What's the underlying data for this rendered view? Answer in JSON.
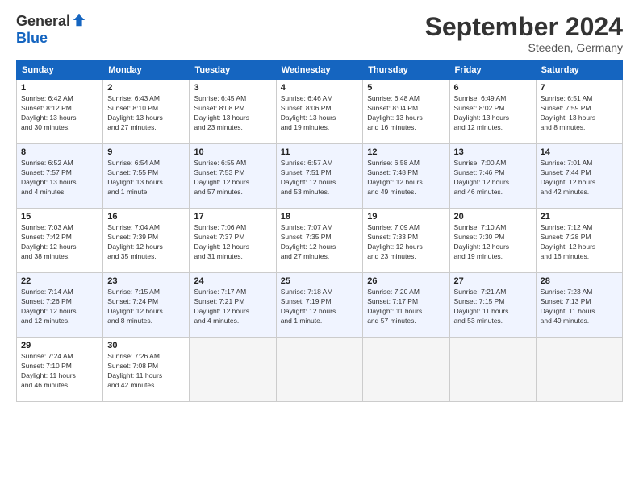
{
  "header": {
    "logo_general": "General",
    "logo_blue": "Blue",
    "month_title": "September 2024",
    "subtitle": "Steeden, Germany"
  },
  "weekdays": [
    "Sunday",
    "Monday",
    "Tuesday",
    "Wednesday",
    "Thursday",
    "Friday",
    "Saturday"
  ],
  "weeks": [
    [
      {
        "day": "1",
        "info": "Sunrise: 6:42 AM\nSunset: 8:12 PM\nDaylight: 13 hours\nand 30 minutes."
      },
      {
        "day": "2",
        "info": "Sunrise: 6:43 AM\nSunset: 8:10 PM\nDaylight: 13 hours\nand 27 minutes."
      },
      {
        "day": "3",
        "info": "Sunrise: 6:45 AM\nSunset: 8:08 PM\nDaylight: 13 hours\nand 23 minutes."
      },
      {
        "day": "4",
        "info": "Sunrise: 6:46 AM\nSunset: 8:06 PM\nDaylight: 13 hours\nand 19 minutes."
      },
      {
        "day": "5",
        "info": "Sunrise: 6:48 AM\nSunset: 8:04 PM\nDaylight: 13 hours\nand 16 minutes."
      },
      {
        "day": "6",
        "info": "Sunrise: 6:49 AM\nSunset: 8:02 PM\nDaylight: 13 hours\nand 12 minutes."
      },
      {
        "day": "7",
        "info": "Sunrise: 6:51 AM\nSunset: 7:59 PM\nDaylight: 13 hours\nand 8 minutes."
      }
    ],
    [
      {
        "day": "8",
        "info": "Sunrise: 6:52 AM\nSunset: 7:57 PM\nDaylight: 13 hours\nand 4 minutes."
      },
      {
        "day": "9",
        "info": "Sunrise: 6:54 AM\nSunset: 7:55 PM\nDaylight: 13 hours\nand 1 minute."
      },
      {
        "day": "10",
        "info": "Sunrise: 6:55 AM\nSunset: 7:53 PM\nDaylight: 12 hours\nand 57 minutes."
      },
      {
        "day": "11",
        "info": "Sunrise: 6:57 AM\nSunset: 7:51 PM\nDaylight: 12 hours\nand 53 minutes."
      },
      {
        "day": "12",
        "info": "Sunrise: 6:58 AM\nSunset: 7:48 PM\nDaylight: 12 hours\nand 49 minutes."
      },
      {
        "day": "13",
        "info": "Sunrise: 7:00 AM\nSunset: 7:46 PM\nDaylight: 12 hours\nand 46 minutes."
      },
      {
        "day": "14",
        "info": "Sunrise: 7:01 AM\nSunset: 7:44 PM\nDaylight: 12 hours\nand 42 minutes."
      }
    ],
    [
      {
        "day": "15",
        "info": "Sunrise: 7:03 AM\nSunset: 7:42 PM\nDaylight: 12 hours\nand 38 minutes."
      },
      {
        "day": "16",
        "info": "Sunrise: 7:04 AM\nSunset: 7:39 PM\nDaylight: 12 hours\nand 35 minutes."
      },
      {
        "day": "17",
        "info": "Sunrise: 7:06 AM\nSunset: 7:37 PM\nDaylight: 12 hours\nand 31 minutes."
      },
      {
        "day": "18",
        "info": "Sunrise: 7:07 AM\nSunset: 7:35 PM\nDaylight: 12 hours\nand 27 minutes."
      },
      {
        "day": "19",
        "info": "Sunrise: 7:09 AM\nSunset: 7:33 PM\nDaylight: 12 hours\nand 23 minutes."
      },
      {
        "day": "20",
        "info": "Sunrise: 7:10 AM\nSunset: 7:30 PM\nDaylight: 12 hours\nand 19 minutes."
      },
      {
        "day": "21",
        "info": "Sunrise: 7:12 AM\nSunset: 7:28 PM\nDaylight: 12 hours\nand 16 minutes."
      }
    ],
    [
      {
        "day": "22",
        "info": "Sunrise: 7:14 AM\nSunset: 7:26 PM\nDaylight: 12 hours\nand 12 minutes."
      },
      {
        "day": "23",
        "info": "Sunrise: 7:15 AM\nSunset: 7:24 PM\nDaylight: 12 hours\nand 8 minutes."
      },
      {
        "day": "24",
        "info": "Sunrise: 7:17 AM\nSunset: 7:21 PM\nDaylight: 12 hours\nand 4 minutes."
      },
      {
        "day": "25",
        "info": "Sunrise: 7:18 AM\nSunset: 7:19 PM\nDaylight: 12 hours\nand 1 minute."
      },
      {
        "day": "26",
        "info": "Sunrise: 7:20 AM\nSunset: 7:17 PM\nDaylight: 11 hours\nand 57 minutes."
      },
      {
        "day": "27",
        "info": "Sunrise: 7:21 AM\nSunset: 7:15 PM\nDaylight: 11 hours\nand 53 minutes."
      },
      {
        "day": "28",
        "info": "Sunrise: 7:23 AM\nSunset: 7:13 PM\nDaylight: 11 hours\nand 49 minutes."
      }
    ],
    [
      {
        "day": "29",
        "info": "Sunrise: 7:24 AM\nSunset: 7:10 PM\nDaylight: 11 hours\nand 46 minutes."
      },
      {
        "day": "30",
        "info": "Sunrise: 7:26 AM\nSunset: 7:08 PM\nDaylight: 11 hours\nand 42 minutes."
      },
      {
        "day": "",
        "info": ""
      },
      {
        "day": "",
        "info": ""
      },
      {
        "day": "",
        "info": ""
      },
      {
        "day": "",
        "info": ""
      },
      {
        "day": "",
        "info": ""
      }
    ]
  ]
}
